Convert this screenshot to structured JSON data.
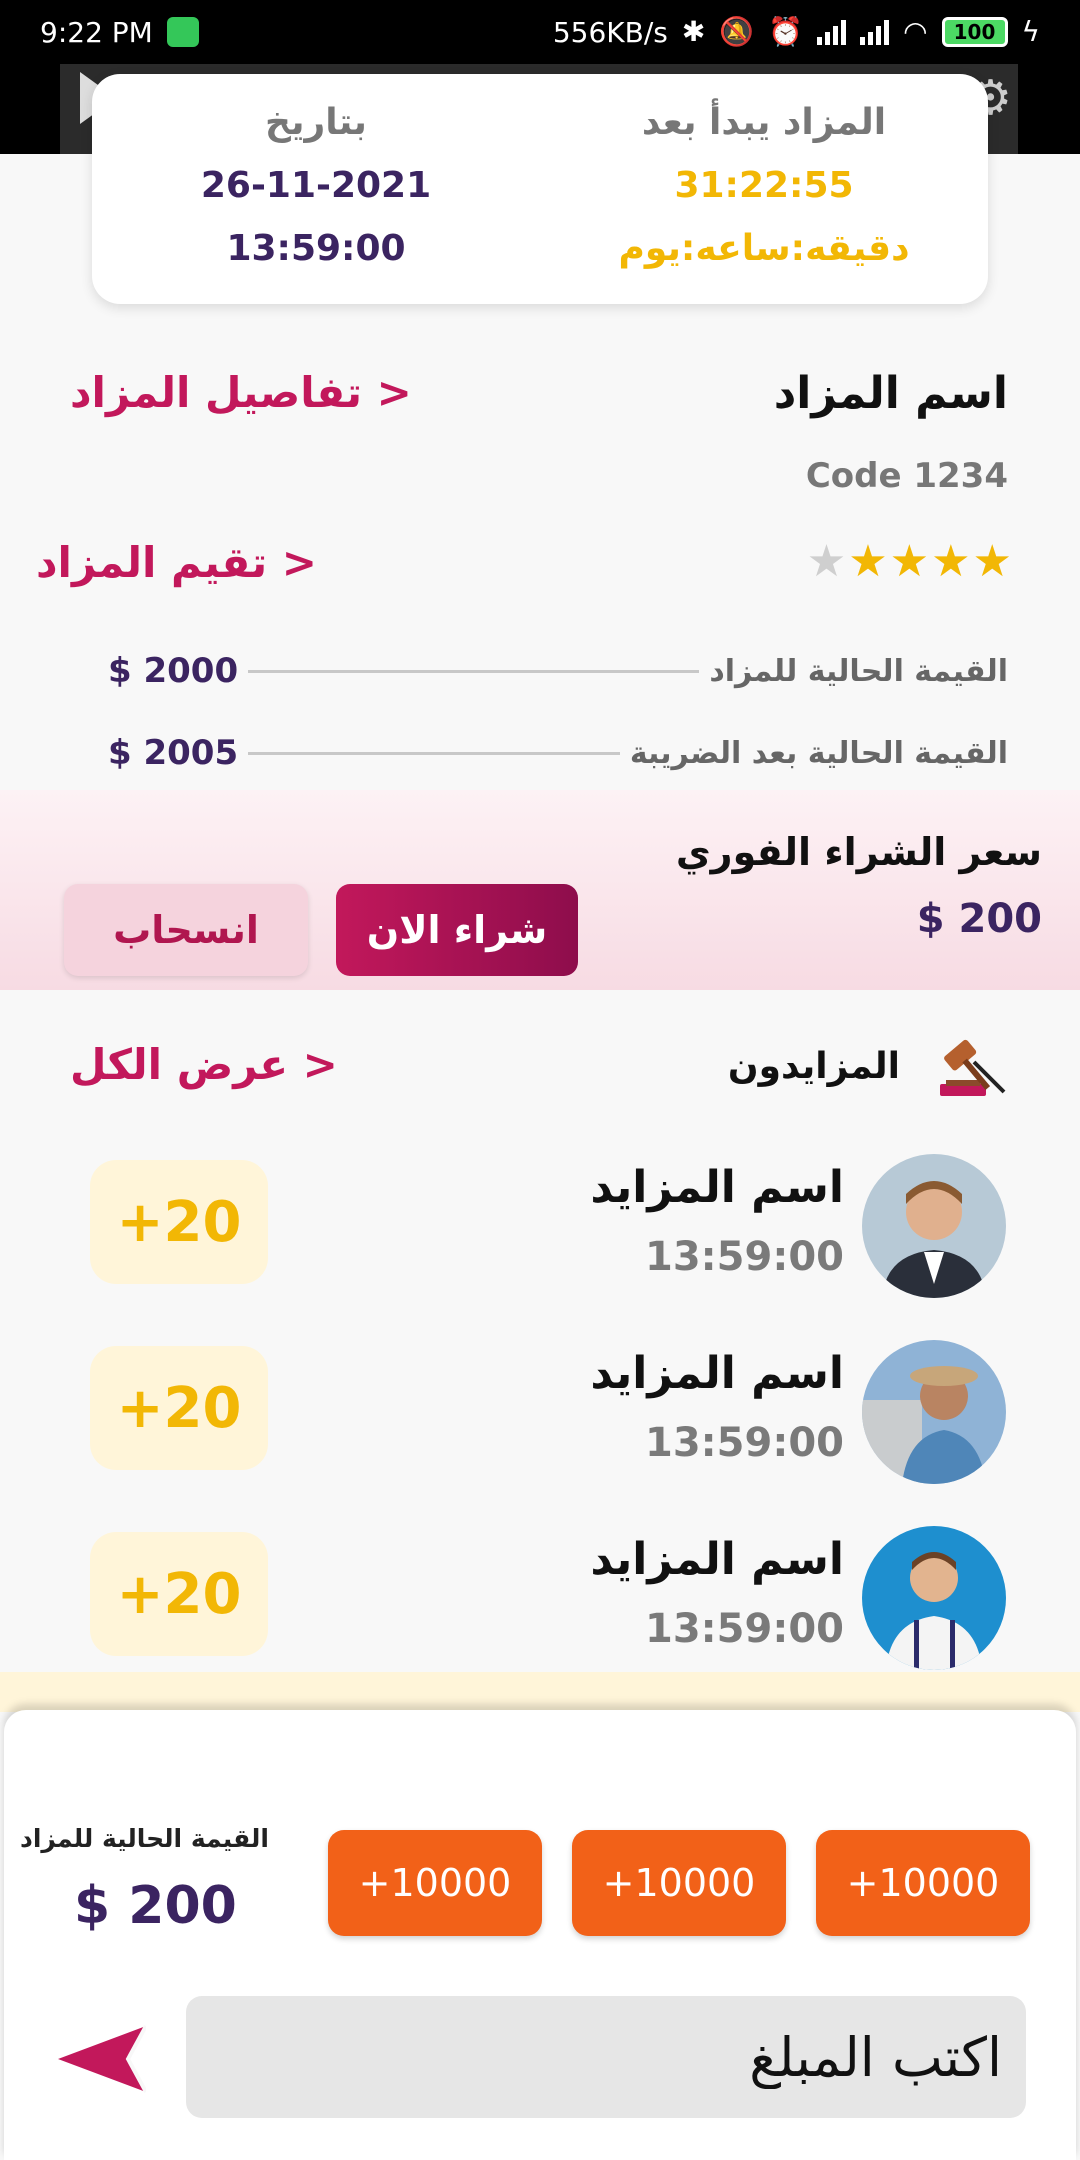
{
  "status_bar": {
    "time": "9:22 PM",
    "net_speed": "556KB/s",
    "battery": "100"
  },
  "timer_card": {
    "starts_in_label": "المزاد يبدأ بعد",
    "countdown": "31:22:55",
    "countdown_units": "دقيقه:ساعه:يوم",
    "date_label": "بتاريخ",
    "date": "26-11-2021",
    "time": "13:59:00"
  },
  "auction": {
    "name": "اسم المزاد",
    "details_link": "تفاصيل المزاد >",
    "code": "Code 1234",
    "rating": 4,
    "rating_max": 5,
    "rate_link": "تقيم المزاد >",
    "current_value_label": "القيمة الحالية للمزاد",
    "current_value": "$ 2000",
    "after_tax_label": "القيمة الحالية بعد الضريبة",
    "after_tax_value": "$ 2005"
  },
  "buy_now": {
    "title": "سعر الشراء الفوري",
    "price": "$ 200",
    "buy_button": "شراء الان",
    "withdraw_button": "انسحاب"
  },
  "bidders": {
    "title": "المزايدون",
    "view_all": "عرض الكل >",
    "items": [
      {
        "name": "اسم المزايد",
        "time": "13:59:00",
        "bid": "+20"
      },
      {
        "name": "اسم المزايد",
        "time": "13:59:00",
        "bid": "+20"
      },
      {
        "name": "اسم المزايد",
        "time": "13:59:00",
        "bid": "+20"
      }
    ]
  },
  "bottom": {
    "current_label": "القيمة الحالية للمزاد",
    "current_value": "$ 200",
    "increments": [
      "+10000",
      "+10000",
      "+10000"
    ],
    "input_placeholder": "اكتب المبلغ"
  },
  "colors": {
    "accent": "#c2185b",
    "purple": "#3b2461",
    "yellow": "#f2b705",
    "orange": "#f26118"
  }
}
